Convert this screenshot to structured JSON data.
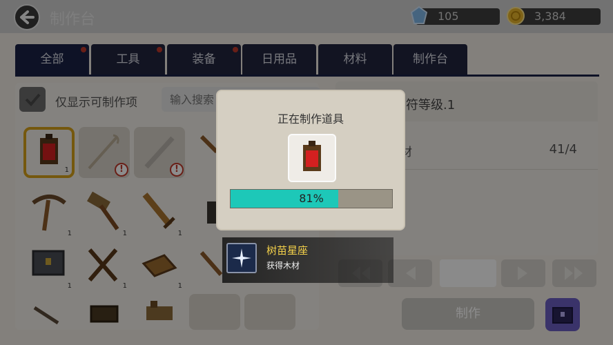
{
  "header": {
    "title": "制作台"
  },
  "currency": {
    "gems": "105",
    "coins": "3,384"
  },
  "tabs": [
    {
      "label": "全部",
      "dot": true
    },
    {
      "label": "工具",
      "dot": true
    },
    {
      "label": "装备",
      "dot": true
    },
    {
      "label": "日用品",
      "dot": false
    },
    {
      "label": "材料",
      "dot": false
    },
    {
      "label": "制作台",
      "dot": false
    }
  ],
  "filter": {
    "label": "仅显示可制作项",
    "search_placeholder": "输入搜索"
  },
  "slots": {
    "s0": {
      "qty": "1",
      "icon": "red-banner-icon"
    },
    "s3": {
      "qty": "1"
    },
    "s4": {
      "qty": "1"
    },
    "s5": {
      "qty": "1"
    },
    "s7": {
      "qty": "1"
    },
    "s8": {
      "qty": "1"
    },
    "s9": {
      "qty": "1"
    },
    "warning_symbol": "!"
  },
  "recipe": {
    "title": "御符等级.1",
    "material_name": "材",
    "material_count": "41/4"
  },
  "craft_label": "制作",
  "dialog": {
    "title": "正在制作道具",
    "progress_text": "81%",
    "progress": 0.81
  },
  "toast": {
    "title": "树苗星座",
    "desc": "获得木材"
  },
  "colors": {
    "tab_bg": "#22253f",
    "progress_fill": "#1dc8b8",
    "selected_border": "#d6a11a",
    "toast_title": "#f4d14a"
  }
}
